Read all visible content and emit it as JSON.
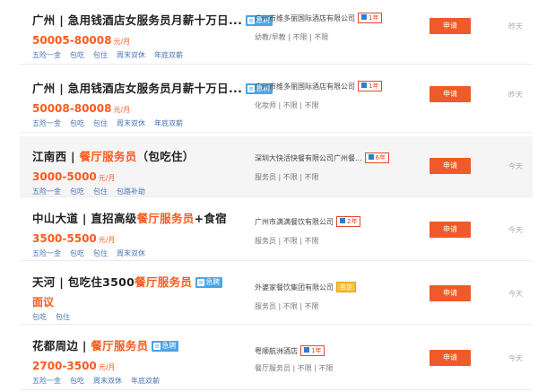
{
  "jobs": [
    {
      "title": "广州 | 急用钱酒店女服务员月薪十万日...",
      "title_hot": "",
      "tag": "急聘",
      "salary": "50005-80008",
      "salary_unit": "元/月",
      "benefits": [
        "五险一金",
        "包吃",
        "包住",
        "周末双休",
        "年底双薪"
      ],
      "company": "广州市维多丽国际酒店有限公司",
      "company_badge": "1年",
      "meta": "幼教/早教 | 不限 | 不限",
      "apply_label": "申请",
      "date": "昨天"
    },
    {
      "title": "广州 | 急用钱酒店女服务员月薪十万日...",
      "title_hot": "",
      "tag": "急聘",
      "salary": "50008-80008",
      "salary_unit": "元/月",
      "benefits": [
        "五险一金",
        "包吃",
        "包住",
        "周末双休",
        "年底双薪"
      ],
      "company": "广州市维多丽国际酒店有限公司",
      "company_badge": "1年",
      "meta": "化妆师 | 不限 | 不限",
      "apply_label": "申请",
      "date": "昨天"
    },
    {
      "title": "江南西 | ",
      "title_hot": "餐厅服务员",
      "title_suffix": "（包吃住）",
      "tag": "",
      "salary": "3000-5000",
      "salary_unit": "元/月",
      "benefits": [
        "五险一金",
        "包吃",
        "包住",
        "包路补助"
      ],
      "company": "深圳大快活快餐有限公司广州餐...",
      "company_badge": "6年",
      "meta": "服务员 | 不限 | 不限",
      "apply_label": "申请",
      "date": "今天"
    },
    {
      "title": "中山大道 | 直招高级",
      "title_hot": "餐厅服务员",
      "title_suffix": "+食宿",
      "tag": "",
      "salary": "3500-5500",
      "salary_unit": "元/月",
      "benefits": [
        "五险一金",
        "包吃",
        "包住",
        "周末双休"
      ],
      "company": "广州市满满餐饮有限公司",
      "company_badge": "2年",
      "meta": "服务员 | 不限 | 不限",
      "apply_label": "申请",
      "date": "今天"
    },
    {
      "title": "天河 | 包吃住3500",
      "title_hot": "餐厅服务员",
      "title_suffix": "",
      "tag": "急聘",
      "salary": "面议",
      "salary_unit": "",
      "benefits": [
        "包吃",
        "包住"
      ],
      "company": "外婆家餐饮集团有限公司",
      "company_badge": "名企",
      "company_badge_gold": true,
      "meta": "服务员 | 不限 | 不限",
      "apply_label": "申请",
      "date": "今天"
    },
    {
      "title": "花都周边 | ",
      "title_hot": "餐厅服务员",
      "title_suffix": "",
      "tag": "急聘",
      "salary": "2700-3500",
      "salary_unit": "元/月",
      "benefits": [
        "五险一金",
        "包吃",
        "周末双休",
        "年底双薪"
      ],
      "company": "粤顺航洲酒店",
      "company_badge": "1年",
      "meta": "餐厅服务员 | 不限 | 不限",
      "apply_label": "申请",
      "date": "今天"
    }
  ]
}
